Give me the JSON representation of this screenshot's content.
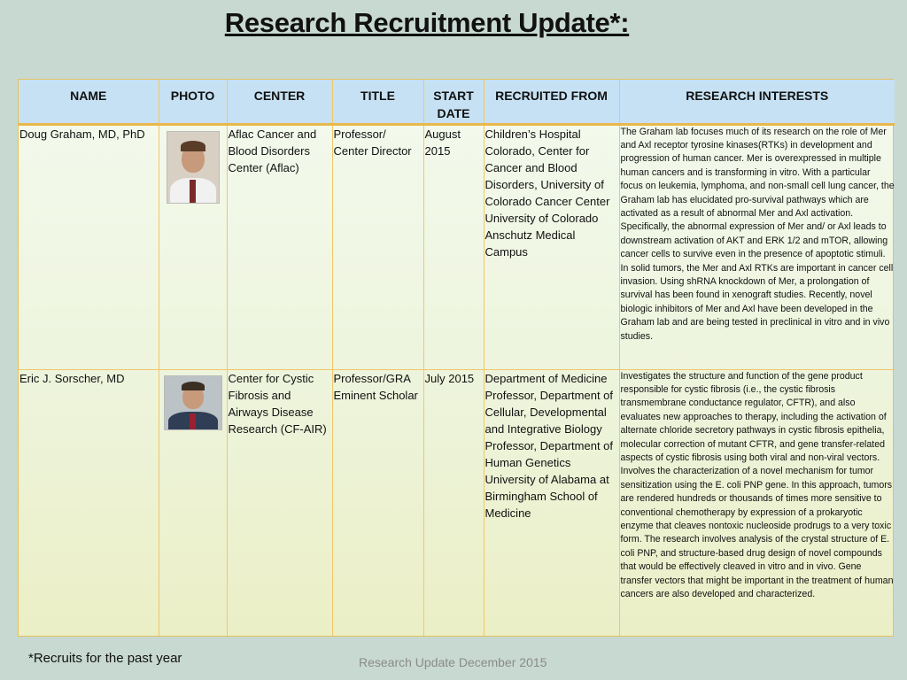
{
  "title": "Research Recruitment Update*:",
  "table": {
    "headers": {
      "name": "NAME",
      "photo": "PHOTO",
      "center": "CENTER",
      "title": "TITLE",
      "start_date": "START DATE",
      "recruited_from": "RECRUITED FROM",
      "research_interests": "RESEARCH INTERESTS"
    },
    "rows": [
      {
        "name": "Doug Graham, MD, PhD",
        "photo_icon": "person-photo",
        "center": "Aflac Cancer and Blood Disorders Center (Aflac)",
        "title": "Professor/ Center Director",
        "start_date": "August 2015",
        "recruited_from": "Children’s Hospital Colorado, Center for Cancer and Blood Disorders, University of Colorado Cancer Center\nUniversity of Colorado Anschutz Medical Campus",
        "research_interests": "The Graham lab focuses much of its research on the role of Mer and Axl receptor tyrosine kinases(RTKs) in development and progression of human cancer. Mer is overexpressed in multiple human cancers and is transforming in vitro. With a particular focus on leukemia, lymphoma, and non-small cell lung cancer, the Graham lab has elucidated pro-survival pathways which are activated as a result of abnormal Mer and Axl activation. Specifically, the abnormal expression of Mer and/ or Axl leads to downstream activation of AKT and ERK 1/2 and mTOR, allowing cancer cells to survive even in the presence of apoptotic stimuli. In solid tumors, the Mer and Axl RTKs are important in cancer cell invasion. Using shRNA knockdown of Mer, a prolongation of survival has been found in xenograft studies. Recently, novel biologic inhibitors of Mer and Axl have been developed in the Graham lab and are being tested in preclinical in vitro and in vivo studies."
      },
      {
        "name": "Eric J. Sorscher, MD",
        "photo_icon": "person-photo",
        "center": "Center for Cystic Fibrosis and Airways Disease Research (CF-AIR)",
        "title": "Professor/GRA Eminent Scholar",
        "start_date": "July 2015",
        "recruited_from": "Department of Medicine\nProfessor, Department of Cellular, Developmental and Integrative Biology\nProfessor, Department of Human Genetics\nUniversity of Alabama at Birmingham School of Medicine",
        "research_interests": "Investigates the structure and function of the gene product responsible for cystic fibrosis (i.e., the cystic fibrosis transmembrane conductance regulator, CFTR), and also evaluates new approaches to therapy, including the activation of alternate chloride secretory pathways in cystic fibrosis epithelia, molecular correction of mutant CFTR, and gene transfer-related aspects of cystic fibrosis using both viral and non-viral vectors.  Involves the characterization of a novel mechanism for tumor sensitization using the E. coli PNP gene. In this approach, tumors are rendered hundreds or thousands of times more sensitive to conventional chemotherapy by expression of a prokaryotic enzyme that cleaves nontoxic nucleoside prodrugs to a very toxic form. The research involves analysis of the crystal structure of E. coli PNP, and structure-based drug design of novel compounds that would be effectively cleaved in vitro and in vivo. Gene transfer vectors that might be important in the treatment of human cancers are also developed and characterized."
      }
    ]
  },
  "footnote": "*Recruits for the past year",
  "footer": "Research Update December 2015"
}
